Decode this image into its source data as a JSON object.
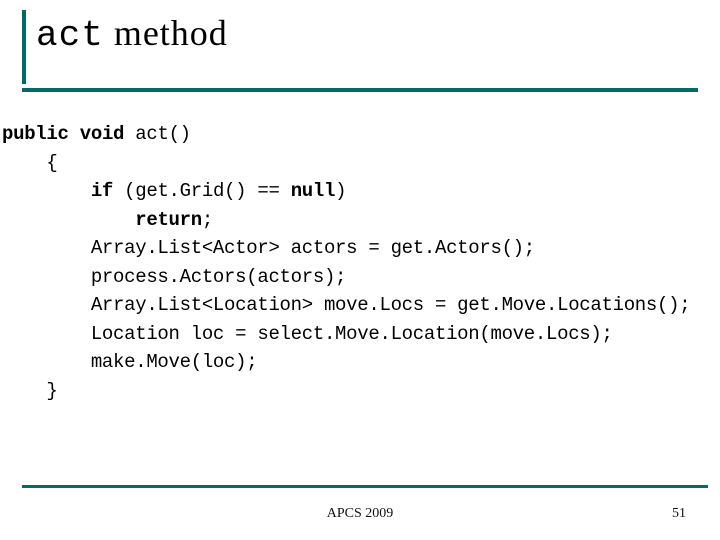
{
  "title": {
    "mono_part": "act",
    "rest": " method"
  },
  "code": {
    "l1_kw1": "public",
    "l1_sp1": " ",
    "l1_kw2": "void",
    "l1_rest": " act()",
    "l2": "    {",
    "l3_pre": "        ",
    "l3_kw1": "if",
    "l3_mid": " (get.Grid() == ",
    "l3_kw2": "null",
    "l3_end": ")",
    "l4_pre": "            ",
    "l4_kw": "return",
    "l4_end": ";",
    "l5": "        Array.List<Actor> actors = get.Actors();",
    "l6": "        process.Actors(actors);",
    "l7": "        Array.List<Location> move.Locs = get.Move.Locations();",
    "l8": "        Location loc = select.Move.Location(move.Locs);",
    "l9": "        make.Move(loc);",
    "l10": "    }"
  },
  "footer": {
    "center": "APCS 2009",
    "page": "51"
  }
}
